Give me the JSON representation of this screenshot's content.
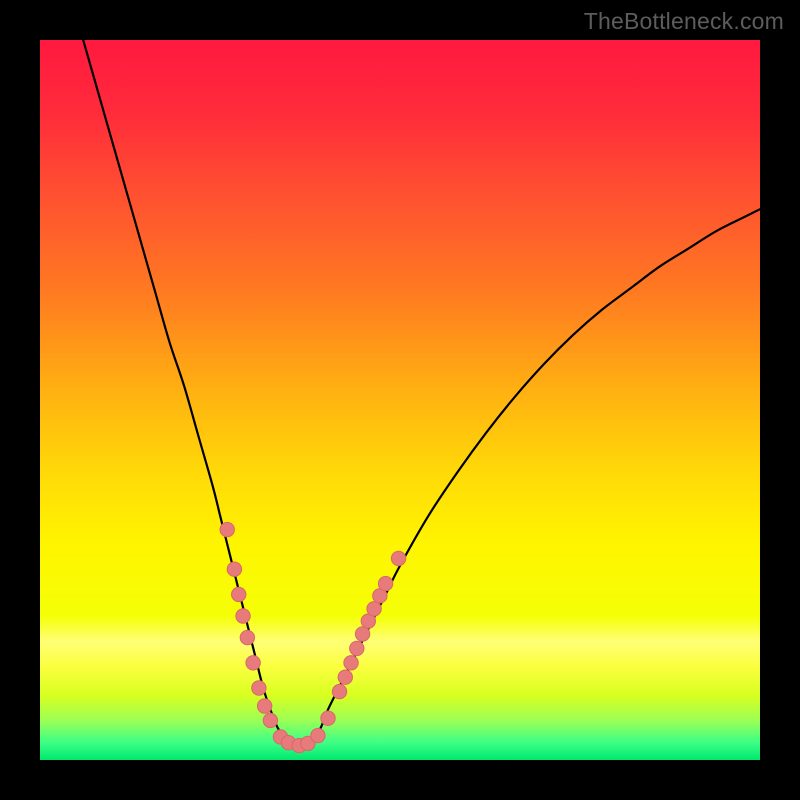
{
  "watermark": "TheBottleneck.com",
  "colors": {
    "frame": "#000000",
    "curve": "#000000",
    "marker_fill": "#e77a7a",
    "marker_stroke": "#d96868",
    "gradient_stops": [
      {
        "offset": 0.0,
        "color": "#ff193f"
      },
      {
        "offset": 0.1,
        "color": "#ff2b3b"
      },
      {
        "offset": 0.22,
        "color": "#ff5230"
      },
      {
        "offset": 0.35,
        "color": "#ff7a21"
      },
      {
        "offset": 0.48,
        "color": "#ffae12"
      },
      {
        "offset": 0.6,
        "color": "#ffd908"
      },
      {
        "offset": 0.7,
        "color": "#fff500"
      },
      {
        "offset": 0.8,
        "color": "#f4ff06"
      },
      {
        "offset": 0.835,
        "color": "#ffff76"
      },
      {
        "offset": 0.87,
        "color": "#fbff3f"
      },
      {
        "offset": 0.91,
        "color": "#d8ff20"
      },
      {
        "offset": 0.945,
        "color": "#9cff55"
      },
      {
        "offset": 0.975,
        "color": "#3fff86"
      },
      {
        "offset": 1.0,
        "color": "#00e86f"
      }
    ]
  },
  "chart_data": {
    "type": "line",
    "title": "",
    "xlabel": "",
    "ylabel": "",
    "xlim": [
      0,
      100
    ],
    "ylim": [
      0,
      100
    ],
    "grid": false,
    "legend": false,
    "series": [
      {
        "name": "bottleneck-curve",
        "x": [
          6,
          8,
          10,
          12,
          14,
          16,
          18,
          20,
          22,
          24,
          25,
          26,
          27,
          28,
          29,
          30,
          31,
          32,
          33,
          34,
          35,
          36,
          37,
          38,
          39,
          40,
          42,
          44,
          46,
          48,
          50,
          54,
          58,
          62,
          66,
          70,
          74,
          78,
          82,
          86,
          90,
          94,
          98,
          100
        ],
        "y": [
          100,
          93,
          86,
          79,
          72,
          65,
          58,
          52,
          45,
          38,
          34,
          30,
          26,
          22,
          18,
          14,
          10,
          7,
          4.5,
          3,
          2.2,
          2,
          2.2,
          3,
          4.5,
          7,
          11,
          15,
          19,
          23,
          27,
          34,
          40,
          45.5,
          50.5,
          55,
          59,
          62.5,
          65.5,
          68.5,
          71,
          73.5,
          75.5,
          76.5
        ]
      }
    ],
    "markers": [
      {
        "x": 26.0,
        "y": 32.0
      },
      {
        "x": 27.0,
        "y": 26.5
      },
      {
        "x": 27.6,
        "y": 23.0
      },
      {
        "x": 28.2,
        "y": 20.0
      },
      {
        "x": 28.8,
        "y": 17.0
      },
      {
        "x": 29.6,
        "y": 13.5
      },
      {
        "x": 30.4,
        "y": 10.0
      },
      {
        "x": 31.2,
        "y": 7.5
      },
      {
        "x": 32.0,
        "y": 5.5
      },
      {
        "x": 33.4,
        "y": 3.2
      },
      {
        "x": 34.5,
        "y": 2.4
      },
      {
        "x": 36.0,
        "y": 2.0
      },
      {
        "x": 37.2,
        "y": 2.3
      },
      {
        "x": 38.6,
        "y": 3.4
      },
      {
        "x": 40.0,
        "y": 5.8
      },
      {
        "x": 41.6,
        "y": 9.5
      },
      {
        "x": 42.4,
        "y": 11.5
      },
      {
        "x": 43.2,
        "y": 13.5
      },
      {
        "x": 44.0,
        "y": 15.5
      },
      {
        "x": 44.8,
        "y": 17.5
      },
      {
        "x": 45.6,
        "y": 19.3
      },
      {
        "x": 46.4,
        "y": 21.0
      },
      {
        "x": 47.2,
        "y": 22.8
      },
      {
        "x": 48.0,
        "y": 24.5
      },
      {
        "x": 49.8,
        "y": 28.0
      }
    ]
  }
}
